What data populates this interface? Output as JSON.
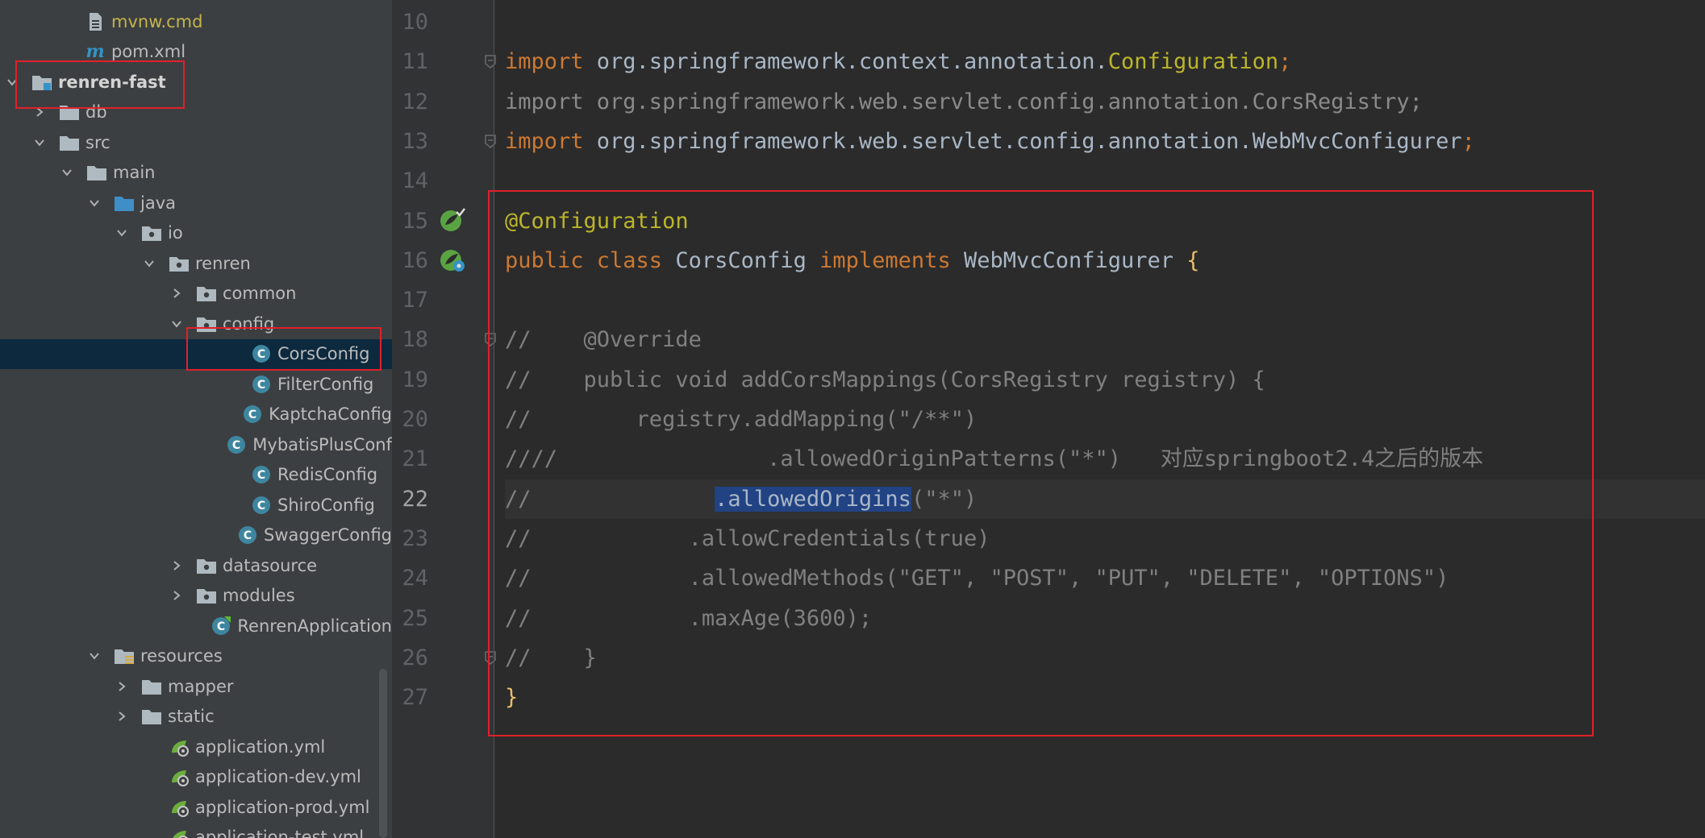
{
  "colors": {
    "sidebar_bg": "#3c3f41",
    "editor_bg": "#2b2b2b",
    "selection_bg": "#0d293e",
    "keyword": "#cc7832",
    "annotation": "#bbb529",
    "comment": "#808080",
    "highlight": "#214283",
    "annotation_box": "#e0202a"
  },
  "project_tree": {
    "items": [
      {
        "label": "mvnw.cmd",
        "icon": "file-cmd-icon"
      },
      {
        "label": "pom.xml",
        "icon": "maven-icon"
      },
      {
        "label": "renren-fast",
        "icon": "module-folder-icon"
      },
      {
        "label": "db",
        "icon": "folder-icon"
      },
      {
        "label": "src",
        "icon": "folder-icon"
      },
      {
        "label": "main",
        "icon": "folder-icon"
      },
      {
        "label": "java",
        "icon": "source-folder-icon"
      },
      {
        "label": "io",
        "icon": "package-icon"
      },
      {
        "label": "renren",
        "icon": "package-icon"
      },
      {
        "label": "common",
        "icon": "package-icon"
      },
      {
        "label": "config",
        "icon": "package-icon"
      },
      {
        "label": "CorsConfig",
        "icon": "class-icon"
      },
      {
        "label": "FilterConfig",
        "icon": "class-icon"
      },
      {
        "label": "KaptchaConfig",
        "icon": "class-icon"
      },
      {
        "label": "MybatisPlusConf",
        "icon": "class-icon"
      },
      {
        "label": "RedisConfig",
        "icon": "class-icon"
      },
      {
        "label": "ShiroConfig",
        "icon": "class-icon"
      },
      {
        "label": "SwaggerConfig",
        "icon": "class-icon"
      },
      {
        "label": "datasource",
        "icon": "package-icon"
      },
      {
        "label": "modules",
        "icon": "package-icon"
      },
      {
        "label": "RenrenApplication",
        "icon": "spring-boot-class-icon"
      },
      {
        "label": "resources",
        "icon": "resources-folder-icon"
      },
      {
        "label": "mapper",
        "icon": "folder-icon"
      },
      {
        "label": "static",
        "icon": "folder-icon"
      },
      {
        "label": "application.yml",
        "icon": "spring-yaml-icon"
      },
      {
        "label": "application-dev.yml",
        "icon": "spring-yaml-icon"
      },
      {
        "label": "application-prod.yml",
        "icon": "spring-yaml-icon"
      },
      {
        "label": "application-test.yml",
        "icon": "spring-yaml-icon"
      }
    ]
  },
  "editor": {
    "current_line": "22",
    "gutter_icons": [
      "spring-bean-icon",
      "spring-config-icon"
    ],
    "lines": [
      {
        "no": "10",
        "parts": []
      },
      {
        "no": "11",
        "parts": [
          {
            "t": "import ",
            "c": "k"
          },
          {
            "t": "org.springframework.context.annotation.",
            "c": "cls"
          },
          {
            "t": "Configuration",
            "c": "ann"
          },
          {
            "t": ";",
            "c": "semi"
          }
        ]
      },
      {
        "no": "12",
        "parts": [
          {
            "t": "import org.springframework.web.servlet.config.annotation.CorsRegistry;",
            "c": "faded"
          }
        ]
      },
      {
        "no": "13",
        "parts": [
          {
            "t": "import ",
            "c": "k"
          },
          {
            "t": "org.springframework.web.servlet.config.annotation.WebMvcConfigurer",
            "c": "cls"
          },
          {
            "t": ";",
            "c": "semi"
          }
        ]
      },
      {
        "no": "14",
        "parts": []
      },
      {
        "no": "15",
        "parts": [
          {
            "t": "@Configuration",
            "c": "ann"
          }
        ]
      },
      {
        "no": "16",
        "parts": [
          {
            "t": "public class ",
            "c": "k"
          },
          {
            "t": "CorsConfig ",
            "c": "cls"
          },
          {
            "t": "implements ",
            "c": "k"
          },
          {
            "t": "WebMvcConfigurer ",
            "c": "cls"
          },
          {
            "t": "{",
            "c": "brace"
          }
        ]
      },
      {
        "no": "17",
        "parts": []
      },
      {
        "no": "18",
        "parts": [
          {
            "t": "//    @Override",
            "c": "cmt"
          }
        ]
      },
      {
        "no": "19",
        "parts": [
          {
            "t": "//    public void addCorsMappings(CorsRegistry registry) {",
            "c": "cmt"
          }
        ]
      },
      {
        "no": "20",
        "parts": [
          {
            "t": "//        registry.addMapping(\"/**\")",
            "c": "cmt"
          }
        ]
      },
      {
        "no": "21",
        "parts": [
          {
            "t": "////                .allowedOriginPatterns(\"*\")   对应springboot2.4之后的版本",
            "c": "cmt"
          }
        ]
      },
      {
        "no": "22",
        "parts": [
          {
            "t": "//              ",
            "c": "cmt"
          },
          {
            "t": ".allowedOrigins",
            "c": "hl"
          },
          {
            "t": "(\"*\")",
            "c": "cmt"
          }
        ]
      },
      {
        "no": "23",
        "parts": [
          {
            "t": "//            .allowCredentials(true)",
            "c": "cmt"
          }
        ]
      },
      {
        "no": "24",
        "parts": [
          {
            "t": "//            .allowedMethods(\"GET\", \"POST\", \"PUT\", \"DELETE\", \"OPTIONS\")",
            "c": "cmt"
          }
        ]
      },
      {
        "no": "25",
        "parts": [
          {
            "t": "//            .maxAge(3600);",
            "c": "cmt"
          }
        ]
      },
      {
        "no": "26",
        "parts": [
          {
            "t": "//    }",
            "c": "cmt"
          }
        ]
      },
      {
        "no": "27",
        "parts": [
          {
            "t": "}",
            "c": "brace"
          }
        ]
      }
    ]
  }
}
